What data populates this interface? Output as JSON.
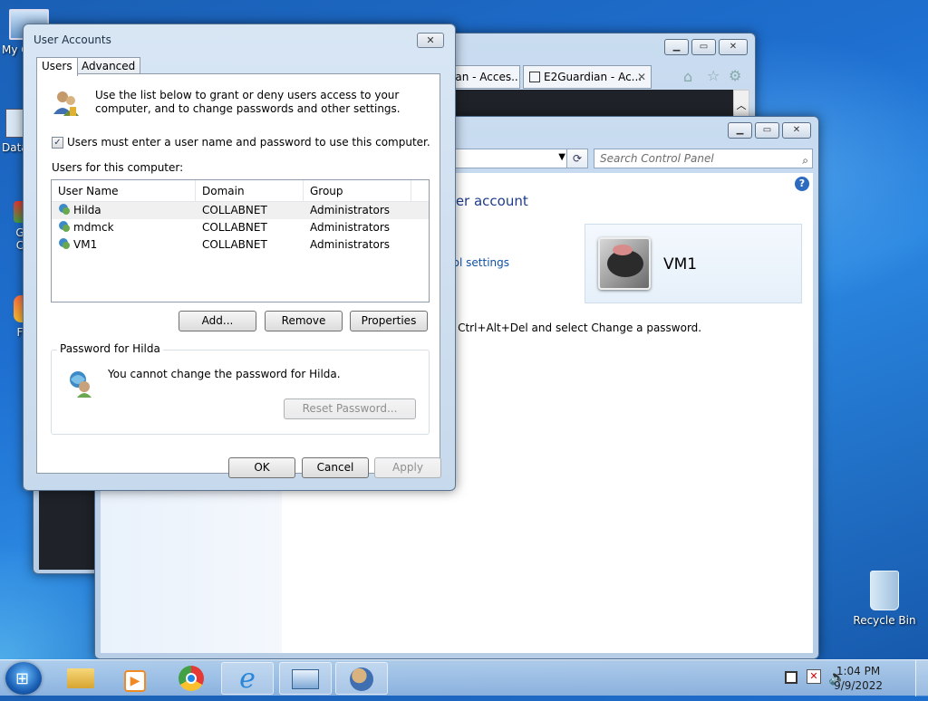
{
  "desktop": {
    "icons": [
      {
        "label": "My C",
        "icon": "computer-icon"
      },
      {
        "label": "Data",
        "icon": "shortcut-icon"
      },
      {
        "label": "G",
        "icon": "chrome-shortcut-icon"
      },
      {
        "label": "C",
        "icon": "shortcut-icon"
      },
      {
        "label": "F",
        "icon": "firefox-shortcut-icon"
      },
      {
        "label": "Recycle Bin",
        "icon": "recycle-bin-icon"
      }
    ]
  },
  "browser": {
    "tabs": [
      {
        "label": "ian - Acces..."
      },
      {
        "label": "E2Guardian - Ac...",
        "close": "✕"
      }
    ],
    "toolbar_icons": [
      "home-icon",
      "favorites-icon",
      "settings-icon"
    ]
  },
  "control_panel": {
    "search_placeholder": "Search Control Panel",
    "title_partial": "ser account",
    "link_partial": "rol settings",
    "text_partial": "s Ctrl+Alt+Del and select Change a password.",
    "user_name": "VM1",
    "help": "?"
  },
  "user_accounts": {
    "title": "User Accounts",
    "close": "✕",
    "tabs": [
      "Users",
      "Advanced"
    ],
    "info": "Use the list below to grant or deny users access to your computer, and to change passwords and other settings.",
    "require_login_label": "Users must enter a user name and password to use this computer.",
    "require_login_checked": true,
    "users_label": "Users for this computer:",
    "columns": [
      "User Name",
      "Domain",
      "Group"
    ],
    "rows": [
      {
        "name": "Hilda",
        "domain": "COLLABNET",
        "group": "Administrators"
      },
      {
        "name": "mdmck",
        "domain": "COLLABNET",
        "group": "Administrators"
      },
      {
        "name": "VM1",
        "domain": "COLLABNET",
        "group": "Administrators"
      }
    ],
    "buttons": {
      "add": "Add...",
      "remove": "Remove",
      "properties": "Properties"
    },
    "password_group_label": "Password for Hilda",
    "password_text": "You cannot change the password for Hilda.",
    "reset_password": "Reset Password...",
    "ok": "OK",
    "cancel": "Cancel",
    "apply": "Apply"
  },
  "taskbar": {
    "clock_time": "1:04 PM",
    "clock_date": "9/9/2022",
    "pinned": [
      "file-explorer-icon",
      "media-player-icon",
      "chrome-icon",
      "internet-explorer-icon",
      "control-panel-icon",
      "user-accounts-icon"
    ],
    "tray_icons": [
      "network-icon",
      "action-center-icon",
      "volume-icon"
    ]
  }
}
